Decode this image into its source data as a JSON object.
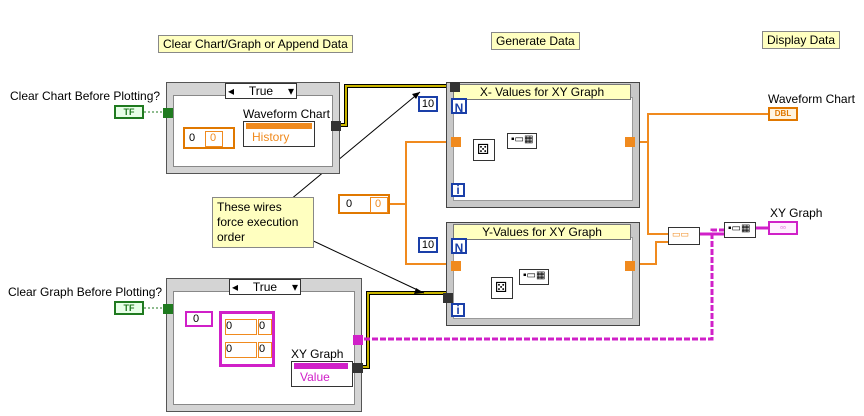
{
  "sections": {
    "clear_label": "Clear Chart/Graph or Append Data",
    "generate_label": "Generate Data",
    "display_label": "Display Data"
  },
  "controls": {
    "clear_chart": "Clear Chart Before Plotting?",
    "clear_graph": "Clear Graph Before Plotting?",
    "bool_glyph": "TF"
  },
  "case_top": {
    "selector": "True",
    "node_label": "Waveform Chart",
    "property": "History",
    "const_a": "0",
    "const_b": "0"
  },
  "case_bottom": {
    "selector": "True",
    "node_label": "XY Graph",
    "property": "Value",
    "const_outer": "0",
    "cluster": [
      "0",
      "0",
      "0",
      "0"
    ]
  },
  "note": "These wires force execution order",
  "loops": {
    "x_title": "X- Values for XY Graph",
    "y_title": "Y-Values for XY Graph",
    "x_count": "10",
    "y_count": "10",
    "n_glyph": "N",
    "i_glyph": "i"
  },
  "input_const": {
    "a": "0",
    "b": "0"
  },
  "indicators": {
    "waveform_label": "Waveform Chart",
    "waveform_glyph": "DBL",
    "xy_label": "XY Graph"
  },
  "colors": {
    "orange_wire": "#f08a1e",
    "pink_wire": "#d020c8",
    "bool_wire": "#1f7a1f",
    "error_wire": "#c8b400"
  }
}
